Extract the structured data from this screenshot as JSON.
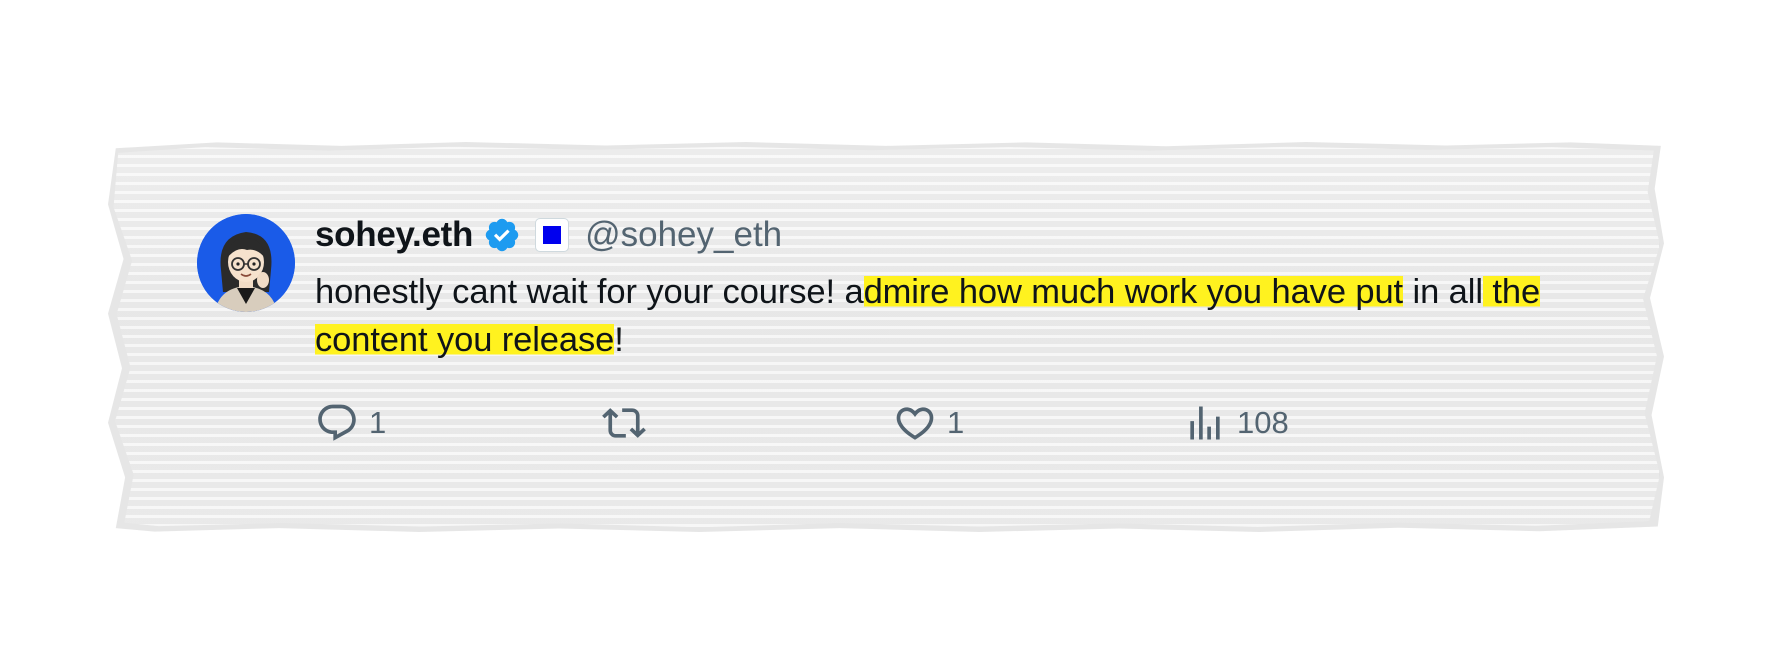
{
  "tweet": {
    "display_name": "sohey.eth",
    "handle": "@sohey_eth",
    "verified": true,
    "affiliate_badge_color": "#0000ee",
    "avatar_bg_color": "#1a5be8",
    "text_segments": [
      {
        "text": "honestly cant wait for your course! a",
        "highlight": false
      },
      {
        "text": "dmire how much work you have put",
        "highlight": true
      },
      {
        "text": " in all",
        "highlight": false
      },
      {
        "text": " the content you release",
        "highlight": true
      },
      {
        "text": "!",
        "highlight": false
      }
    ],
    "highlight_color": "#fff21f"
  },
  "actions": {
    "reply": {
      "icon": "reply-icon",
      "count": "1"
    },
    "retweet": {
      "icon": "retweet-icon",
      "count": ""
    },
    "like": {
      "icon": "heart-icon",
      "count": "1"
    },
    "views": {
      "icon": "views-icon",
      "count": "108"
    }
  }
}
